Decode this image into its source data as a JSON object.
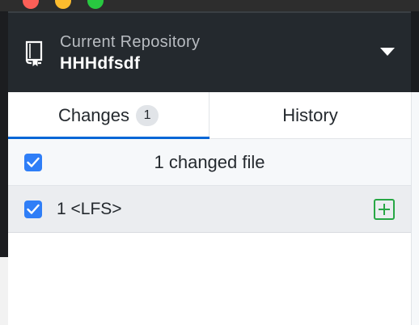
{
  "window": {
    "buttons": [
      "close",
      "minimize",
      "zoom"
    ]
  },
  "repository": {
    "label": "Current Repository",
    "name": "HHHdfsdf",
    "icon": "repo-icon",
    "dropdown_icon": "triangle-down-icon"
  },
  "tabs": [
    {
      "label": "Changes",
      "count": "1",
      "active": true
    },
    {
      "label": "History",
      "active": false
    }
  ],
  "changes": {
    "summary": "1 changed file",
    "select_all_checked": true,
    "files": [
      {
        "name": "1 <LFS>",
        "checked": true,
        "status": "added",
        "status_icon": "diff-added-icon"
      }
    ]
  },
  "colors": {
    "accent": "#0366d6",
    "checkbox": "#2f7ef7",
    "added": "#28a745",
    "header_bg": "#24292e"
  }
}
